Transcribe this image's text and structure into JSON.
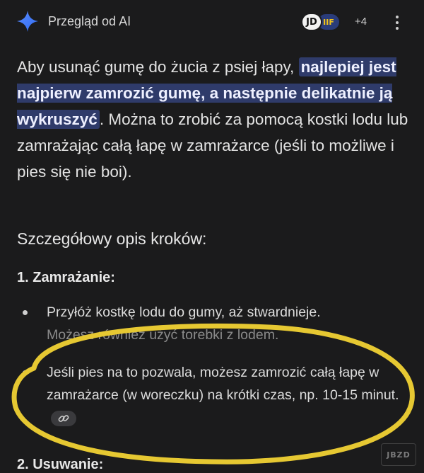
{
  "header": {
    "title": "Przegląd od AI",
    "sparkle_icon": "gemini-sparkle-icon",
    "sources": [
      {
        "label": "JD",
        "icon": "source-jd-icon"
      },
      {
        "label": "IIF",
        "icon": "source-news-icon"
      }
    ],
    "more_sources": "+4",
    "menu_icon": "more-vert-icon"
  },
  "answer": {
    "intro_before": "Aby usunąć gumę do żucia z psiej łapy, ",
    "intro_highlight": "najlepiej jest najpierw zamrozić gumę, a następnie delikatnie ją wykruszyć",
    "intro_after": ". Można to zrobić za pomocą kostki lodu lub zamrażając całą łapę w zamrażarce (jeśli to możliwe i pies się nie boi).",
    "section_heading": "Szczegółowy opis kroków:",
    "steps": [
      {
        "title": "1. Zamrażanie:",
        "bullets": [
          "Przyłóż kostkę lodu do gumy, aż stwardnieje.",
          "Możesz również użyć torebki z lodem.",
          "Jeśli pies na to pozwala, możesz zamrozić całą łapę w zamrażarce (w woreczku) na krótki czas, np. 10-15 minut."
        ]
      },
      {
        "title": "2. Usuwanie:"
      }
    ],
    "link_icon": "link-icon"
  },
  "overlay": {
    "highlight_color": "#e6c832",
    "watermark": "JBZD"
  }
}
